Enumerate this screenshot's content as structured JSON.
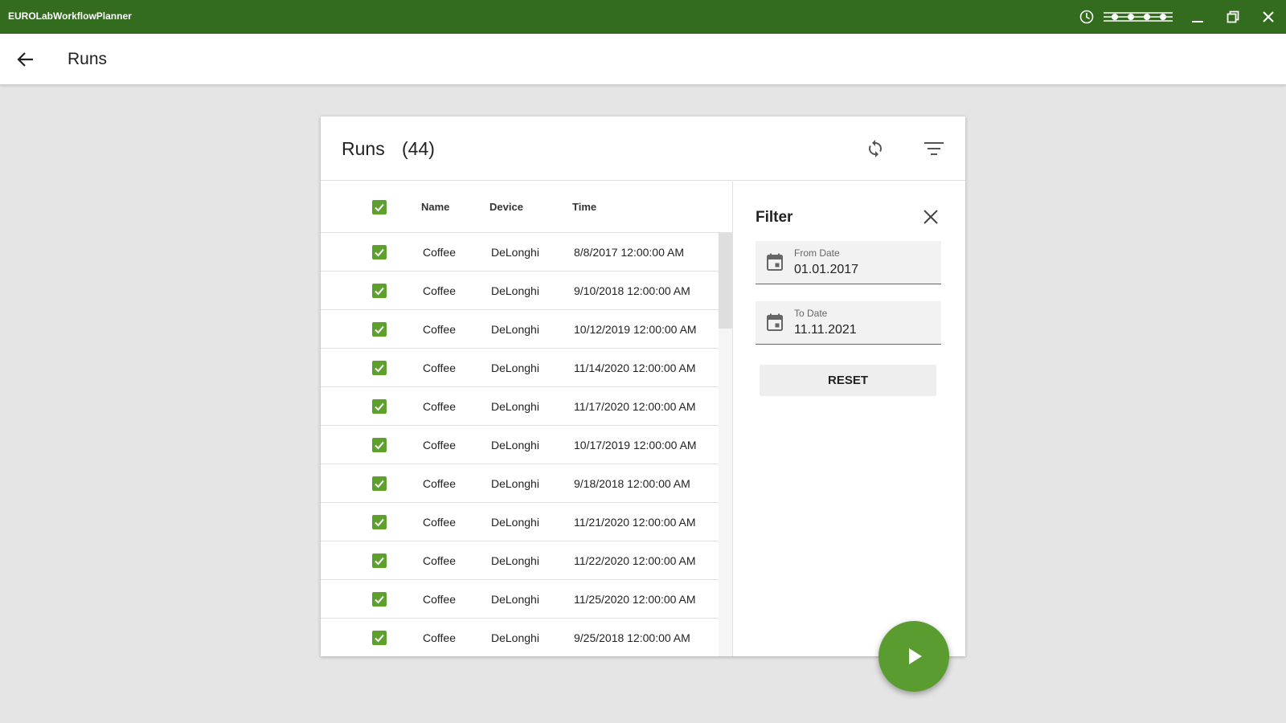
{
  "window": {
    "title": "EUROLabWorkflowPlanner",
    "icons": [
      "clock-icon",
      "dots-indicator-icon",
      "minimize-icon",
      "restore-icon",
      "close-icon"
    ]
  },
  "appbar": {
    "title": "Runs",
    "back_icon": "arrow-left-icon"
  },
  "card": {
    "title": "Runs",
    "count": "(44)",
    "refresh_icon": "refresh-icon",
    "filter_icon": "filter-list-icon"
  },
  "table": {
    "columns": [
      "Name",
      "Device",
      "Time"
    ],
    "all_selected": true,
    "rows": [
      {
        "name": "Coffee",
        "device": "DeLonghi",
        "time": "8/8/2017 12:00:00 AM",
        "checked": true
      },
      {
        "name": "Coffee",
        "device": "DeLonghi",
        "time": "9/10/2018 12:00:00 AM",
        "checked": true
      },
      {
        "name": "Coffee",
        "device": "DeLonghi",
        "time": "10/12/2019 12:00:00 AM",
        "checked": true
      },
      {
        "name": "Coffee",
        "device": "DeLonghi",
        "time": "11/14/2020 12:00:00 AM",
        "checked": true
      },
      {
        "name": "Coffee",
        "device": "DeLonghi",
        "time": "11/17/2020 12:00:00 AM",
        "checked": true
      },
      {
        "name": "Coffee",
        "device": "DeLonghi",
        "time": "10/17/2019 12:00:00 AM",
        "checked": true
      },
      {
        "name": "Coffee",
        "device": "DeLonghi",
        "time": "9/18/2018 12:00:00 AM",
        "checked": true
      },
      {
        "name": "Coffee",
        "device": "DeLonghi",
        "time": "11/21/2020 12:00:00 AM",
        "checked": true
      },
      {
        "name": "Coffee",
        "device": "DeLonghi",
        "time": "11/22/2020 12:00:00 AM",
        "checked": true
      },
      {
        "name": "Coffee",
        "device": "DeLonghi",
        "time": "11/25/2020 12:00:00 AM",
        "checked": true
      },
      {
        "name": "Coffee",
        "device": "DeLonghi",
        "time": "9/25/2018 12:00:00 AM",
        "checked": true
      }
    ]
  },
  "filter": {
    "title": "Filter",
    "from_label": "From Date",
    "from_value": "01.01.2017",
    "to_label": "To Date",
    "to_value": "11.11.2021",
    "reset_label": "RESET"
  },
  "fab": {
    "icon": "play-icon"
  },
  "colors": {
    "titlebar": "#336b1f",
    "accent": "#5ea02e",
    "fab": "#5a9c30",
    "background": "#e5e5e5"
  }
}
